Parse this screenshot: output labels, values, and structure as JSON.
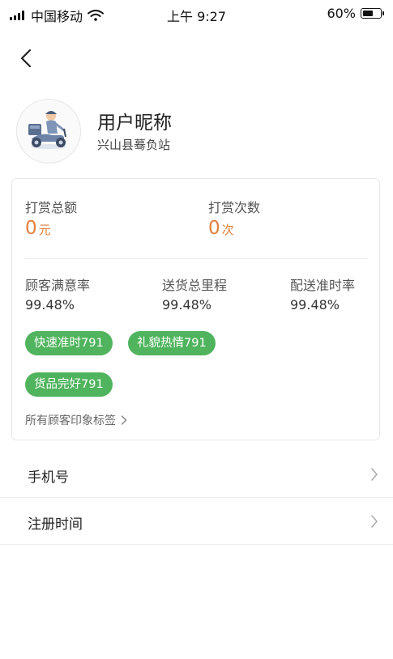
{
  "status_bar": {
    "carrier": "中国移动",
    "time": "上午 9:27",
    "battery": "60%",
    "icons": [
      "signal-icon",
      "wifi-icon",
      "battery-icon"
    ]
  },
  "nav": {
    "back_icon": "back-arrow-icon"
  },
  "profile": {
    "nickname": "用户昵称",
    "station": "兴山县蓦负站",
    "avatar_icon": "delivery-scooter-avatar"
  },
  "stats": {
    "reward_total": {
      "label": "打赏总额",
      "value": "0",
      "unit": "元"
    },
    "reward_count": {
      "label": "打赏次数",
      "value": "0",
      "unit": "次"
    },
    "metrics": [
      {
        "label": "顾客满意率",
        "value": "99.48%"
      },
      {
        "label": "送货总里程",
        "value": "99.48%"
      },
      {
        "label": "配送准时率",
        "value": "99.48%"
      }
    ],
    "tags": [
      {
        "label": "快速准时791"
      },
      {
        "label": "礼貌热情791"
      },
      {
        "label": "货品完好791"
      }
    ],
    "all_tags_link": "所有顾客印象标签"
  },
  "rows": [
    {
      "label": "手机号"
    },
    {
      "label": "注册时间"
    }
  ],
  "colors": {
    "accent_orange": "#e57f3c",
    "tag_green": "#4fb45d",
    "border": "#e8e8e8"
  }
}
